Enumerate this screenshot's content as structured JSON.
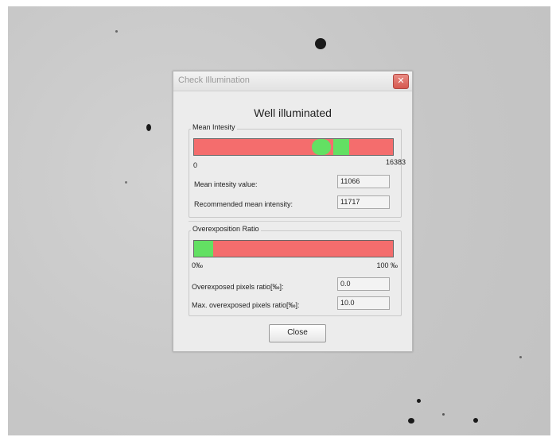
{
  "dialog": {
    "title": "Check Illumination",
    "status": "Well illuminated",
    "close_button_label": "Close",
    "close_x_glyph": "✕"
  },
  "mean_intensity": {
    "group_label": "Mean Intesity",
    "min_label": "0",
    "max_label": "16383",
    "range": [
      0,
      16383
    ],
    "measured_marker": 11066,
    "recommended_marker": 11717,
    "value_label": "Mean intesity value:",
    "value": "11066",
    "recommended_label": "Recommended mean intensity:",
    "recommended": "11717"
  },
  "overexposition": {
    "group_label": "Overexposition Ratio",
    "min_label": "0‰",
    "max_label": "100 ‰",
    "ratio_label": "Overexposed pixels ratio[‰]:",
    "ratio": "0.0",
    "max_ratio_label": "Max. overexposed pixels ratio[‰]:",
    "max_ratio": "10.0"
  },
  "colors": {
    "bar_red": "#f46d6d",
    "bar_green": "#63e063"
  }
}
